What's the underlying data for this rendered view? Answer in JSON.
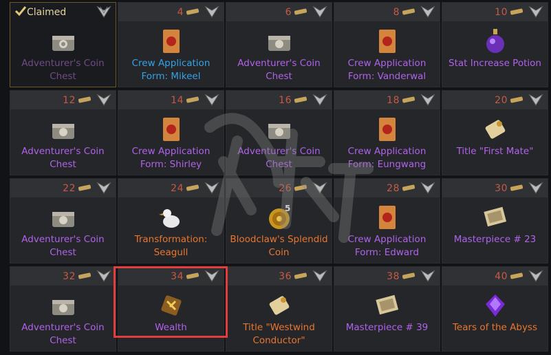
{
  "rewards": [
    {
      "claimed": true,
      "claimed_label": "Claimed",
      "name": "Adventurer's Coin Chest",
      "icon": "coin-chest-icon"
    },
    {
      "number": "4",
      "name": "Crew Application Form: Mikeel",
      "icon": "crew-application-icon",
      "rarity": "blue"
    },
    {
      "number": "6",
      "name": "Adventurer's Coin Chest",
      "icon": "coin-chest-icon",
      "rarity": "purple"
    },
    {
      "number": "8",
      "name": "Crew Application Form: Vanderwal",
      "icon": "crew-application-icon",
      "rarity": "purple"
    },
    {
      "number": "10",
      "name": "Stat Increase Potion",
      "icon": "potion-icon",
      "rarity": "purple"
    },
    {
      "number": "12",
      "name": "Adventurer's Coin Chest",
      "icon": "coin-chest-icon",
      "rarity": "purple"
    },
    {
      "number": "14",
      "name": "Crew Application Form: Shirley",
      "icon": "crew-application-icon",
      "rarity": "purple"
    },
    {
      "number": "16",
      "name": "Adventurer's Coin Chest",
      "icon": "coin-chest-icon",
      "rarity": "purple"
    },
    {
      "number": "18",
      "name": "Crew Application Form: Eungwang",
      "icon": "crew-application-icon",
      "rarity": "purple"
    },
    {
      "number": "20",
      "name": "Title \"First Mate\"",
      "icon": "title-scroll-icon",
      "rarity": "purple"
    },
    {
      "number": "22",
      "name": "Adventurer's Coin Chest",
      "icon": "coin-chest-icon",
      "rarity": "purple"
    },
    {
      "number": "24",
      "name": "Transformation: Seagull",
      "icon": "seagull-icon",
      "rarity": "orange"
    },
    {
      "number": "26",
      "name": "Bloodclaw's Splendid Coin",
      "icon": "splendid-coin-icon",
      "rarity": "orange",
      "count": "5"
    },
    {
      "number": "28",
      "name": "Crew Application Form: Edward",
      "icon": "crew-application-icon",
      "rarity": "purple"
    },
    {
      "number": "30",
      "name": "Masterpiece # 23",
      "icon": "masterpiece-icon",
      "rarity": "purple"
    },
    {
      "number": "32",
      "name": "Adventurer's Coin Chest",
      "icon": "coin-chest-icon",
      "rarity": "purple"
    },
    {
      "number": "34",
      "name": "Wealth",
      "icon": "wealth-rune-icon",
      "rarity": "purple"
    },
    {
      "number": "36",
      "name": "Title \"Westwind Conductor\"",
      "icon": "title-scroll-icon",
      "rarity": "orange"
    },
    {
      "number": "38",
      "name": "Masterpiece # 39",
      "icon": "masterpiece-icon",
      "rarity": "purple"
    },
    {
      "number": "40",
      "name": "Tears of the Abyss",
      "icon": "abyss-gem-icon",
      "rarity": "orange"
    }
  ],
  "colors": {
    "purple": "#b063e8",
    "blue": "#36a2e6",
    "orange": "#e8762f",
    "number": "#c85a45",
    "highlight": "#e53d3d"
  }
}
